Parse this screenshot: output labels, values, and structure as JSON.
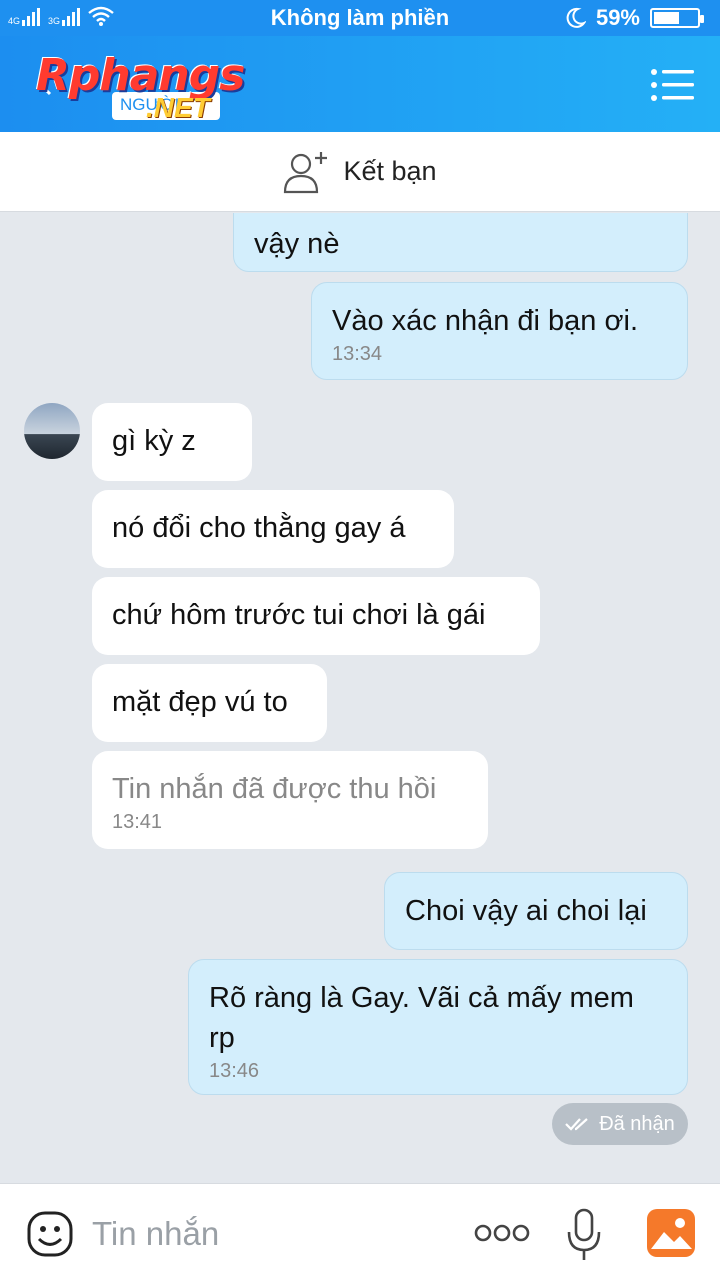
{
  "status_bar": {
    "network_1": "4G",
    "network_2": "3G",
    "title": "Không làm phiền",
    "battery": "59%",
    "battery_level": 0.59
  },
  "header": {
    "logo_text": "Rphangs",
    "logo_net": ".NET",
    "logo_sub": "NGƯỜI"
  },
  "add_friend": {
    "label": "Kết bạn"
  },
  "messages": [
    {
      "side": "me",
      "text": "vậy nè"
    },
    {
      "side": "me",
      "text": "Vào xác nhận đi bạn ơi.",
      "time": "13:34"
    },
    {
      "side": "them",
      "text": "gì kỳ z"
    },
    {
      "side": "them",
      "text": "nó đổi cho thằng gay á"
    },
    {
      "side": "them",
      "text": "chứ hôm trước tui chơi là gái"
    },
    {
      "side": "them",
      "text": "mặt đẹp vú to"
    },
    {
      "side": "them",
      "text": "Tin nhắn đã được thu hồi",
      "time": "13:41"
    },
    {
      "side": "me",
      "text": "Choi vậy ai choi lại"
    },
    {
      "side": "me",
      "text": "Rõ ràng là Gay. Vãi cả mấy mem rp",
      "time": "13:46"
    }
  ],
  "delivered_label": "Đã nhận",
  "input": {
    "placeholder": "Tin nhắn"
  },
  "colors": {
    "header": "#1e90f0",
    "bubble_me": "#d3eefc",
    "bubble_them": "#ffffff",
    "chat_bg": "#e4e8ed"
  }
}
